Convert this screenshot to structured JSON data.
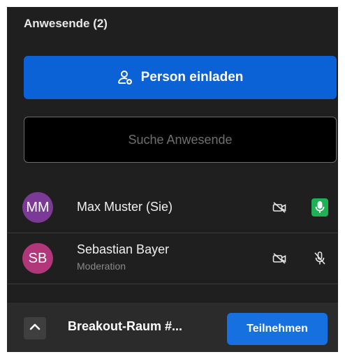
{
  "panel": {
    "title": "Anwesende (2)"
  },
  "invite_button": {
    "label": "Person einladen",
    "icon": "person-add-icon",
    "color": "#0b62d6"
  },
  "search": {
    "placeholder": "Suche Anwesende",
    "value": ""
  },
  "participants": [
    {
      "initials": "MM",
      "name": "Max Muster (Sie)",
      "role": "",
      "avatar_color": "#7b3a96",
      "camera": "off",
      "mic": "on",
      "mic_color": "#1fb155"
    },
    {
      "initials": "SB",
      "name": "Sebastian Bayer",
      "role": "Moderation",
      "avatar_color": "#b1367a",
      "camera": "off",
      "mic": "off"
    }
  ],
  "breakout": {
    "room_name": "Breakout-Raum #...",
    "join_label": "Teilnehmen",
    "join_color": "#1670e0",
    "toggle_icon": "chevron-up-icon"
  }
}
